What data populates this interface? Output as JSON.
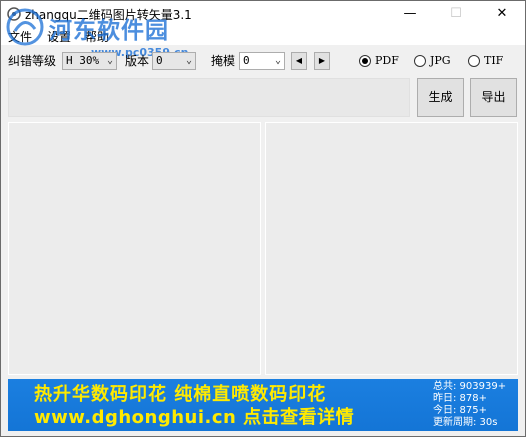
{
  "window": {
    "title": "zhangqu二维码图片转矢量3.1",
    "controls": {
      "minimize": "—",
      "maximize": "☐",
      "close": "✕"
    }
  },
  "watermark": {
    "site_name": "河东软件园",
    "url": "www.pc0359.cn"
  },
  "menu": {
    "file": "文件",
    "settings": "设置",
    "help": "帮助"
  },
  "toolbar": {
    "error_level_label": "纠错等级",
    "error_level_value": "H 30%",
    "version_label": "版本",
    "version_value": "0",
    "mask_label": "掩模",
    "mask_value": "0",
    "prev_symbol": "◀",
    "next_symbol": "▶"
  },
  "format": {
    "selected": "PDF",
    "options": [
      {
        "label": "PDF",
        "checked": true
      },
      {
        "label": "JPG",
        "checked": false
      },
      {
        "label": "TIF",
        "checked": false
      }
    ]
  },
  "actions": {
    "generate": "生成",
    "export": "导出"
  },
  "input": {
    "value": ""
  },
  "ad": {
    "line1": "热升华数码印花  纯棉直喷数码印花",
    "line2": "www.dghonghui.cn  点击查看详情",
    "stats": {
      "total": "总共: 903939+",
      "yesterday": "昨日: 878+",
      "today": "今日: 875+",
      "refresh": "更新周期: 30s"
    }
  },
  "colors": {
    "banner_bg": "#1475d6",
    "banner_text": "#ffea00",
    "watermark": "#1a6fd6"
  }
}
